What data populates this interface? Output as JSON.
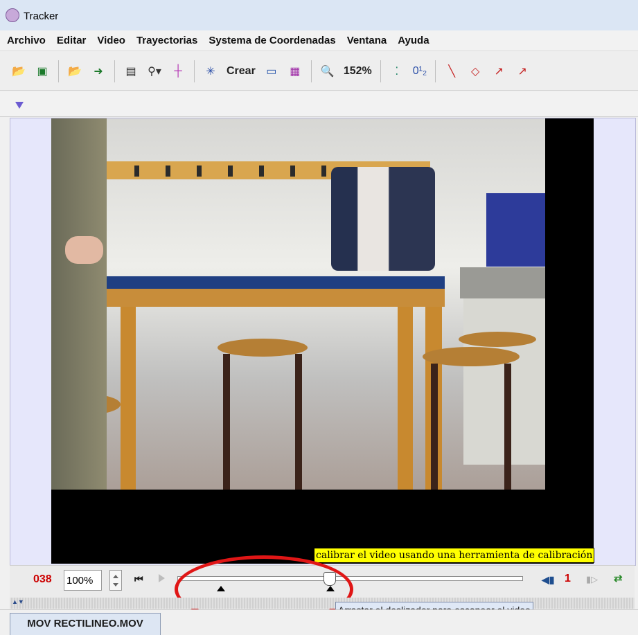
{
  "window": {
    "title": "Tracker"
  },
  "menubar": [
    "Archivo",
    "Editar",
    "Video",
    "Trayectorias",
    "Systema de Coordenadas",
    "Ventana",
    "Ayuda"
  ],
  "toolbar": {
    "create_label": "Crear",
    "zoom_label": "152%",
    "step_label": "0¹₂"
  },
  "tooltips": {
    "calibration": "calibrar el video usando una herramienta de calibración",
    "slider": "Arrastar el deslizador para escanear el video"
  },
  "player": {
    "frame_number": "038",
    "zoom_value": "100%",
    "step_size": "1",
    "slider_position": 0.44
  },
  "tab": {
    "filename": "MOV RECTILINEO.MOV"
  },
  "colors": {
    "frame_number": "#cc0000",
    "tooltip_bg": "#ffff00",
    "annotation_circle": "#e01616"
  }
}
